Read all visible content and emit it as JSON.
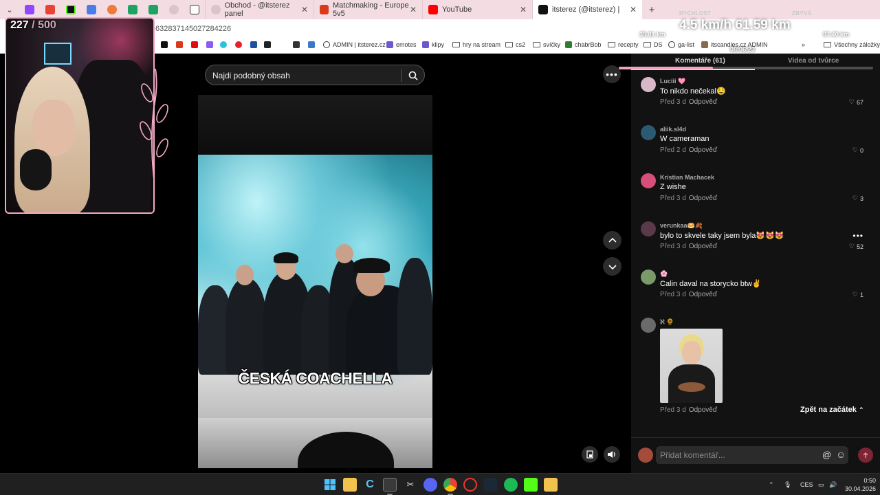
{
  "browser": {
    "tabs": [
      {
        "label": "Obchod - @itsterez panel"
      },
      {
        "label": "Matchmaking - Europe 5v5"
      },
      {
        "label": "YouTube"
      },
      {
        "label": "itsterez (@itsterez) | TikTok"
      }
    ],
    "url_fragment": "632837145027284226",
    "bookmarks": [
      "ADMIN | itsterez.cz",
      "emotes",
      "klipy",
      "hry na stream",
      "cs2",
      "svíčky",
      "chabrBob",
      "recepty",
      "DS",
      "ga-list",
      "itscandles.cz ADMIN",
      "Všechny záložky"
    ]
  },
  "stream_overlay": {
    "counter_current": "227",
    "counter_separator": "/",
    "counter_max": "500",
    "speed_label": "RYCHLOST",
    "remaining_label": "ZBÝVÁ",
    "speed_value": "4.5 km/h",
    "distance_value": "61.59 km",
    "left_distance": "35.81 km",
    "right_distance": "97.40 km",
    "timer": "08:06:23",
    "progress": 0.37
  },
  "search": {
    "placeholder": "Najdi podobný obsah"
  },
  "video": {
    "caption": "ČESKÁ COACHELLA"
  },
  "comments": {
    "tab_comments": "Komentáře (61)",
    "tab_creator_videos": "Videa od tvůrce",
    "items": [
      {
        "user": "Luciii 🩷",
        "text": "To nikdo nečekal🤤",
        "time": "Před 3 d",
        "reply": "Odpověď",
        "likes": "67",
        "avatar_color": "#d8b8c8"
      },
      {
        "user": "aliik.sl4d",
        "text": "W cameraman",
        "time": "Před 2 d",
        "reply": "Odpověď",
        "likes": "0",
        "avatar_color": "#2b5a73"
      },
      {
        "user": "Kristian Machacek",
        "text": "Z wishe",
        "time": "Před 3 d",
        "reply": "Odpověď",
        "likes": "3",
        "avatar_color": "#d64f7a"
      },
      {
        "user": "verunkaa🥯🍂",
        "text": "bylo to skvele taky jsem byla😻😻😻",
        "time": "Před 3 d",
        "reply": "Odpověď",
        "likes": "52",
        "avatar_color": "#5a3a4a"
      },
      {
        "user": "🌸",
        "text": "Calin daval na storycko btw✌️",
        "time": "Před 3 d",
        "reply": "Odpověď",
        "likes": "1",
        "avatar_color": "#7a9a6a"
      },
      {
        "user": "ℵ 🌻",
        "text": "",
        "time": "Před 3 d",
        "reply": "Odpověď",
        "likes": "",
        "avatar_color": "#6a6a6a"
      }
    ],
    "back_to_top": "Zpět na začátek",
    "input_placeholder": "Přidat komentář..."
  },
  "taskbar": {
    "language": "CES",
    "time": "0:50",
    "date": "30.04.2026"
  },
  "colors": {
    "accent": "#fe2c55",
    "panel_bg": "#121212",
    "overlay_pink": "#f4aac5"
  }
}
